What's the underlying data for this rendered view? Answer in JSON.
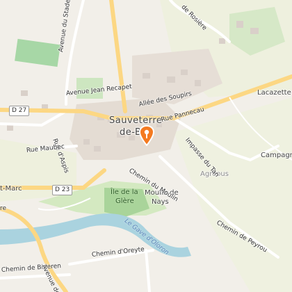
{
  "map": {
    "town": "Sauveterre-de-Béarn",
    "town_line1": "Sauveterre",
    "town_line2": "de-Bé",
    "places": {
      "lacazette": "Lacazette",
      "campagne": "Campagne",
      "agreous": "Agreous",
      "moulin_line1": "Moulin de",
      "moulin_line2": "Nays",
      "saint_marc": "t-Marc"
    },
    "island": {
      "line1": "Île de la",
      "line2": "Glère"
    },
    "river": "Le Gave d'Oloron",
    "roads": {
      "d27": "D 27",
      "d23": "D 23",
      "allee_soupirs": "Allée des Soupirs",
      "rue_pannecau": "Rue Pannecau",
      "impasse_tan": "Impasse du Tan",
      "chemin_moulin": "Chemin du Moulin",
      "chemin_peyrou": "Chemin de Peyrou",
      "avenue_recapet": "Avenue Jean Recapet",
      "avenue_stade": "Avenue du Stade",
      "rue_aspis": "Rue d'Aspis",
      "rue_maubec": "Rue Maubec",
      "chemin_oreyte": "Chemin d'Oreyte",
      "chemin_bideren": "Chemin de Bideren",
      "avenue_de": "Avenue de",
      "rosiere": "de Rosière",
      "cut_left": "re"
    },
    "colors": {
      "background": "#f2efe9",
      "river": "#aad3df",
      "greenery": "#c8e6b0",
      "road": "#ffffff",
      "primary_road": "#f7d46b",
      "marker": "#f47a20"
    }
  }
}
